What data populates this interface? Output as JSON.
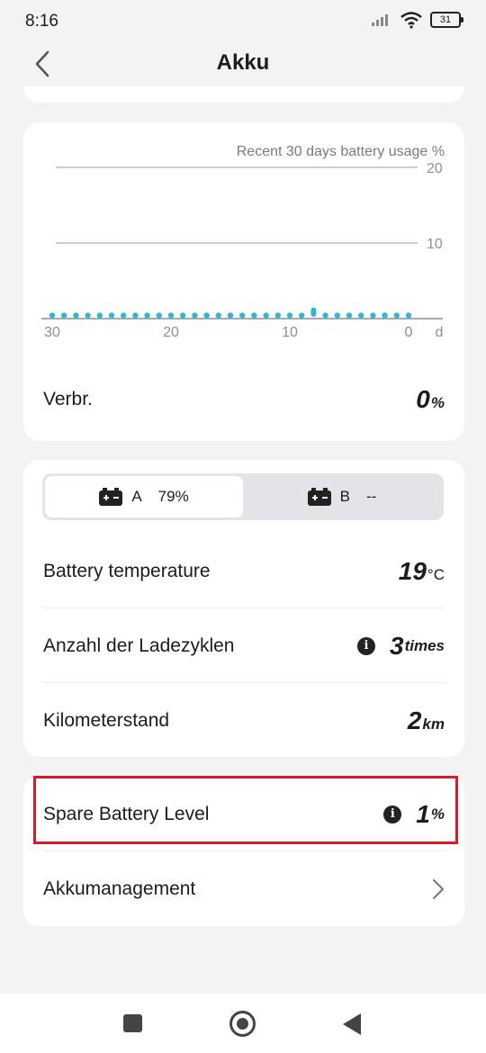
{
  "status_bar": {
    "time": "8:16",
    "battery_level": "31"
  },
  "nav": {
    "title": "Akku"
  },
  "usage_card": {
    "chart_caption": "Recent 30 days battery usage %",
    "usage_label": "Verbr.",
    "usage_value": "0",
    "usage_unit": "%"
  },
  "chart_data": {
    "type": "scatter",
    "title": "Recent 30 days battery usage %",
    "xlabel": "d",
    "ylabel": "",
    "x_ticks": [
      "30",
      "20",
      "10",
      "0"
    ],
    "y_ticks": [
      "10",
      "20"
    ],
    "xlim": [
      30,
      0
    ],
    "ylim": [
      0,
      20
    ],
    "series": [
      {
        "x": [
          30,
          29,
          28,
          27,
          26,
          25,
          24,
          23,
          22,
          21,
          20,
          19,
          18,
          17,
          16,
          15,
          14,
          13,
          12,
          11,
          10,
          9,
          8,
          7,
          6,
          5,
          4,
          3,
          2,
          1,
          0
        ],
        "values": [
          0,
          0,
          0,
          0,
          0,
          0,
          0,
          0,
          0,
          0,
          0,
          0,
          0,
          0,
          0,
          0,
          0,
          0,
          0,
          0,
          0,
          0,
          1,
          0,
          0,
          0,
          0,
          0,
          0,
          0,
          0
        ]
      }
    ],
    "grid": true,
    "colors": {
      "point": "#2fb8d6",
      "grid": "#bdbdc2",
      "axis": "#8e8e93"
    }
  },
  "battery_card": {
    "tabs": [
      {
        "name": "A",
        "percent": "79%"
      },
      {
        "name": "B",
        "percent": "--"
      }
    ],
    "rows": [
      {
        "label": "Battery temperature",
        "value": "19",
        "unit": "°C"
      },
      {
        "label": "Anzahl der Ladezyklen",
        "value": "3",
        "unit": "times"
      },
      {
        "label": "Kilometerstand",
        "value": "2",
        "unit": "km"
      }
    ]
  },
  "spare_card": {
    "spare_label": "Spare Battery Level",
    "spare_value": "1",
    "spare_unit": "%",
    "management_label": "Akkumanagement"
  },
  "colors": {
    "highlight": "#d7192a",
    "accent": "#2fb8d6"
  }
}
